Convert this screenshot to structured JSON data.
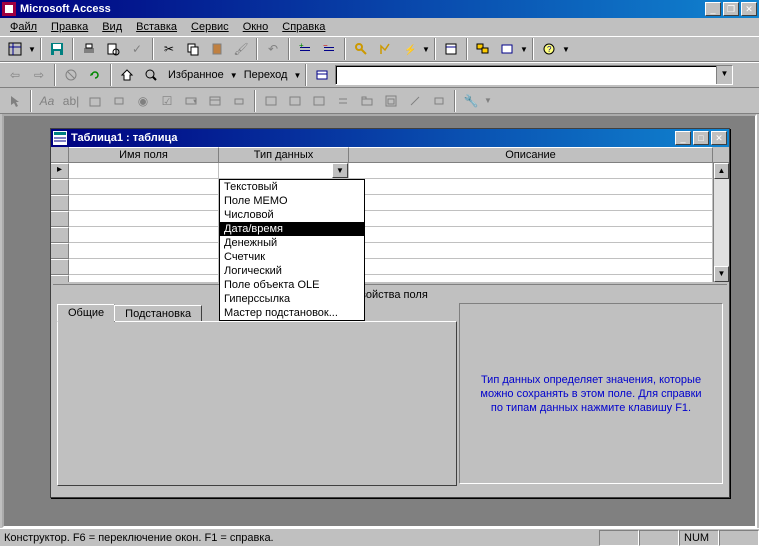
{
  "app": {
    "title": "Microsoft Access"
  },
  "menu": {
    "file": "Файл",
    "edit": "Правка",
    "view": "Вид",
    "insert": "Вставка",
    "tools": "Сервис",
    "window": "Окно",
    "help": "Справка"
  },
  "toolbar2": {
    "favorites": "Избранное",
    "goto": "Переход"
  },
  "child": {
    "title": "Таблица1 : таблица"
  },
  "grid": {
    "col_fieldname": "Имя поля",
    "col_datatype": "Тип данных",
    "col_description": "Описание"
  },
  "datatype_options": [
    "Текстовый",
    "Поле MEMO",
    "Числовой",
    "Дата/время",
    "Денежный",
    "Счетчик",
    "Логический",
    "Поле объекта OLE",
    "Гиперссылка",
    "Мастер подстановок..."
  ],
  "datatype_selected_index": 3,
  "props": {
    "section_label": "Свойства поля",
    "tab_general": "Общие",
    "tab_lookup": "Подстановка",
    "help_text": "Тип данных определяет значения, которые можно сохранять в этом поле.  Для справки по типам данных нажмите клавишу F1."
  },
  "status": {
    "text": "Конструктор.  F6 = переключение окон.  F1 = справка.",
    "num": "NUM"
  }
}
